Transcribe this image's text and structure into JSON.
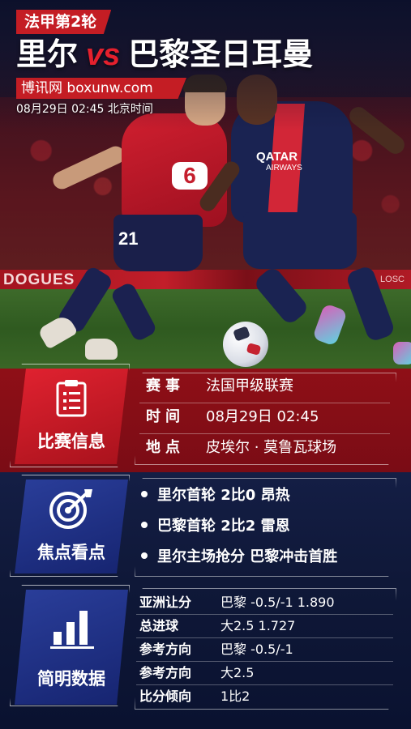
{
  "header": {
    "round_tag": "法甲第2轮",
    "home_team": "里尔",
    "vs": "vs",
    "away_team": "巴黎圣日耳曼",
    "site": "博讯网  boxunw.com",
    "datetime": "08月29日 02:45 北京时间"
  },
  "photo": {
    "adboard_left": "DOGUES",
    "adboard_right": "LOSC",
    "lille_number": "21",
    "lille_logo": "6",
    "psg_sponsor": "QATAR",
    "psg_sponsor_sub": "AIRWAYS"
  },
  "match_info": {
    "label": "比赛信息",
    "rows": [
      {
        "key": "赛事",
        "value": "法国甲级联赛"
      },
      {
        "key": "时间",
        "value": "08月29日  02:45"
      },
      {
        "key": "地点",
        "value": "皮埃尔 · 莫鲁瓦球场"
      }
    ]
  },
  "highlights": {
    "label": "焦点看点",
    "items": [
      "里尔首轮  2比0  昂热",
      "巴黎首轮  2比2  雷恩",
      "里尔主场抢分  巴黎冲击首胜"
    ]
  },
  "data": {
    "label": "简明数据",
    "rows": [
      {
        "key": "亚洲让分",
        "value": "巴黎  -0.5/-1   1.890"
      },
      {
        "key": "总进球",
        "value": "大2.5    1.727"
      },
      {
        "key": "参考方向",
        "value": "巴黎  -0.5/-1"
      },
      {
        "key": "参考方向",
        "value": "大2.5"
      },
      {
        "key": "比分倾向",
        "value": "1比2"
      }
    ]
  },
  "colors": {
    "accent_red": "#c41d24",
    "navy": "#0f1838",
    "vs_red": "#e5202d"
  }
}
